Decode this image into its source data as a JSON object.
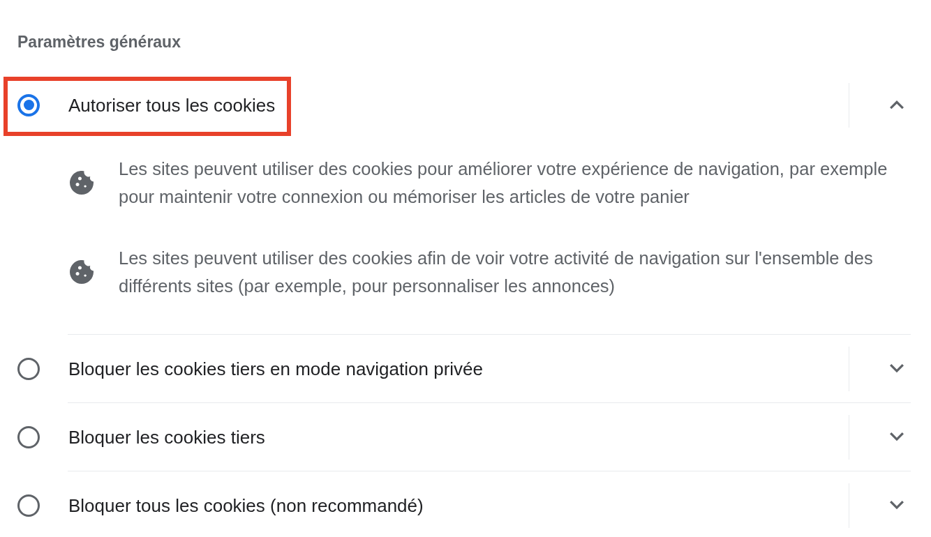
{
  "heading": "Paramètres généraux",
  "options": [
    {
      "label": "Autoriser tous les cookies",
      "selected": true,
      "highlighted": true,
      "expanded": true,
      "details": [
        "Les sites peuvent utiliser des cookies pour améliorer votre expérience de navigation, par exemple pour maintenir votre connexion ou mémoriser les articles de votre panier",
        "Les sites peuvent utiliser des cookies afin de voir votre activité de navigation sur l'ensemble des différents sites (par exemple, pour personnaliser les annonces)"
      ]
    },
    {
      "label": "Bloquer les cookies tiers en mode navigation privée",
      "selected": false,
      "highlighted": false,
      "expanded": false
    },
    {
      "label": "Bloquer les cookies tiers",
      "selected": false,
      "highlighted": false,
      "expanded": false
    },
    {
      "label": "Bloquer tous les cookies (non recommandé)",
      "selected": false,
      "highlighted": false,
      "expanded": false
    }
  ]
}
